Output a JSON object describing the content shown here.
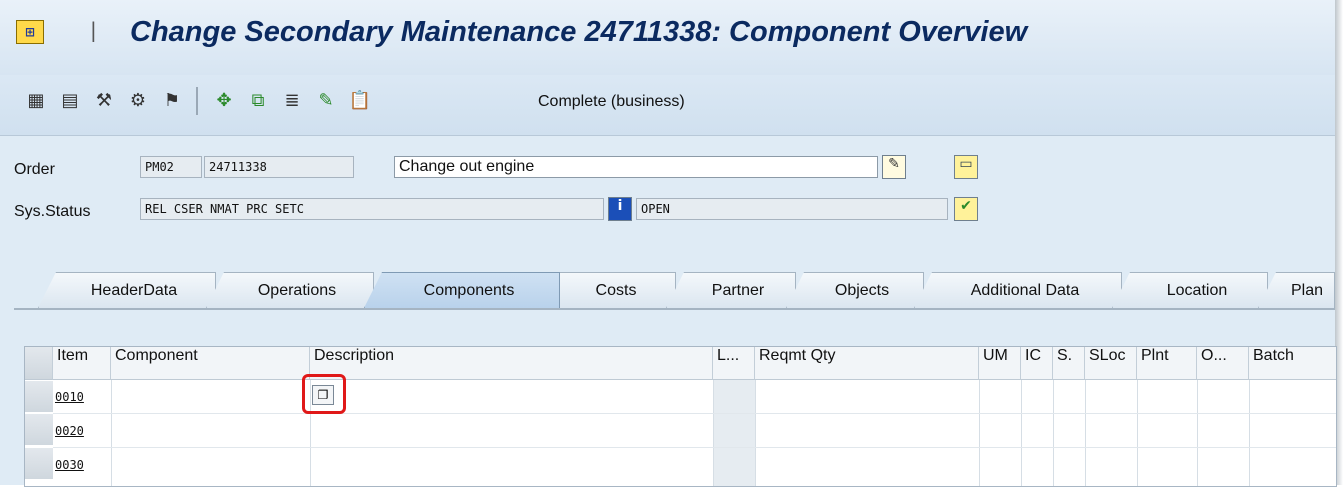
{
  "window": {
    "title": "Change Secondary Maintenance 24711338: Component Overview",
    "menu_icon": "sap-menu-icon"
  },
  "toolbar": {
    "icons": [
      "header-icon",
      "calculator-icon",
      "operations-icon",
      "components-icon",
      "flag-icon",
      "bom-icon",
      "copy-icon",
      "doc-icon",
      "pencil-icon",
      "clipboard-icon"
    ],
    "complete_label": "Complete (business)"
  },
  "header": {
    "order_label": "Order",
    "order_type": "PM02",
    "order_number": "24711338",
    "order_description": "Change out engine",
    "sys_status_label": "Sys.Status",
    "sys_status_value": "REL  CSER NMAT PRC  SETC",
    "user_status_value": "OPEN"
  },
  "tabs": [
    {
      "label": "HeaderData",
      "active": false
    },
    {
      "label": "Operations",
      "active": false
    },
    {
      "label": "Components",
      "active": true
    },
    {
      "label": "Costs",
      "active": false
    },
    {
      "label": "Partner",
      "active": false
    },
    {
      "label": "Objects",
      "active": false
    },
    {
      "label": "Additional Data",
      "active": false
    },
    {
      "label": "Location",
      "active": false
    },
    {
      "label": "Plan",
      "active": false
    }
  ],
  "table": {
    "columns": [
      "Item",
      "Component",
      "Description",
      "L...",
      "Reqmt Qty",
      "UM",
      "IC",
      "S.",
      "SLoc",
      "Plnt",
      "O...",
      "Batch"
    ],
    "rows": [
      {
        "item": "0010"
      },
      {
        "item": "0020"
      },
      {
        "item": "0030"
      }
    ]
  },
  "colors": {
    "highlight": "#e01818",
    "title": "#0b2a60",
    "background": "#dfebf5"
  }
}
